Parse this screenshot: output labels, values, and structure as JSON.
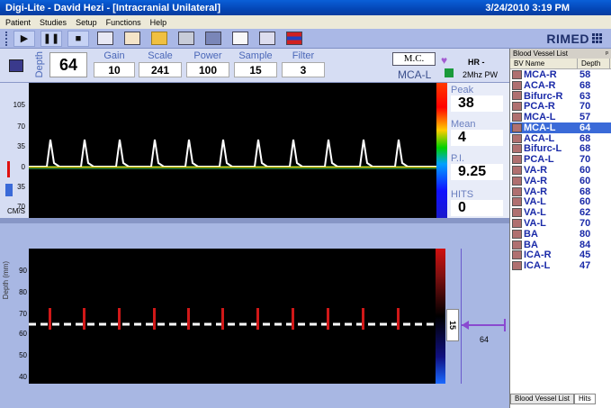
{
  "window": {
    "title": "Digi-Lite - David Hezi - [Intracranial Unilateral]",
    "datetime": "3/24/2010  3:19 PM"
  },
  "menu": [
    "Patient",
    "Studies",
    "Setup",
    "Functions",
    "Help"
  ],
  "toolbar": {
    "play_label": "▶",
    "pause_label": "❚❚",
    "stop_label": "■"
  },
  "brand": "RIMED",
  "params": {
    "depth_label": "Depth",
    "depth_value": "64",
    "gain_label": "Gain",
    "gain_value": "10",
    "scale_label": "Scale",
    "scale_value": "241",
    "power_label": "Power",
    "power_value": "100",
    "sample_label": "Sample",
    "sample_value": "15",
    "filter_label": "Filter",
    "filter_value": "3",
    "mc_label": "M.C.",
    "vessel": "MCA-L",
    "hr_label": "HR -",
    "probe": "2Mhz PW"
  },
  "spectrum": {
    "ticks": [
      "105",
      "70",
      "35",
      "0",
      "35",
      "70"
    ],
    "unit": "CM/S"
  },
  "stats": {
    "peak_label": "Peak",
    "peak_value": "38",
    "mean_label": "Mean",
    "mean_value": "4",
    "pi_label": "P.I.",
    "pi_value": "9.25",
    "hits_label": "HITS",
    "hits_value": "0"
  },
  "mmode": {
    "ticks": [
      "90",
      "80",
      "70",
      "60",
      "50",
      "40"
    ],
    "ylabel": "Depth (mm)",
    "gate_value": "15",
    "depth_marker": "64"
  },
  "vessel_list": {
    "title": "Blood Vessel List",
    "pin": "ᵖ",
    "col_name": "BV Name",
    "col_depth": "Depth",
    "rows": [
      {
        "name": "MCA-R",
        "depth": "58"
      },
      {
        "name": "ACA-R",
        "depth": "68"
      },
      {
        "name": "Bifurc-R",
        "depth": "63"
      },
      {
        "name": "PCA-R",
        "depth": "70"
      },
      {
        "name": "MCA-L",
        "depth": "57"
      },
      {
        "name": "MCA-L",
        "depth": "64"
      },
      {
        "name": "ACA-L",
        "depth": "68"
      },
      {
        "name": "Bifurc-L",
        "depth": "68"
      },
      {
        "name": "PCA-L",
        "depth": "70"
      },
      {
        "name": "VA-R",
        "depth": "60"
      },
      {
        "name": "VA-R",
        "depth": "60"
      },
      {
        "name": "VA-R",
        "depth": "68"
      },
      {
        "name": "VA-L",
        "depth": "60"
      },
      {
        "name": "VA-L",
        "depth": "62"
      },
      {
        "name": "VA-L",
        "depth": "70"
      },
      {
        "name": "BA",
        "depth": "80"
      },
      {
        "name": "BA",
        "depth": "84"
      },
      {
        "name": "ICA-R",
        "depth": "45"
      },
      {
        "name": "ICA-L",
        "depth": "47"
      }
    ],
    "selected_index": 5,
    "tab_list": "Blood Vessel List",
    "tab_hits": "Hits"
  }
}
